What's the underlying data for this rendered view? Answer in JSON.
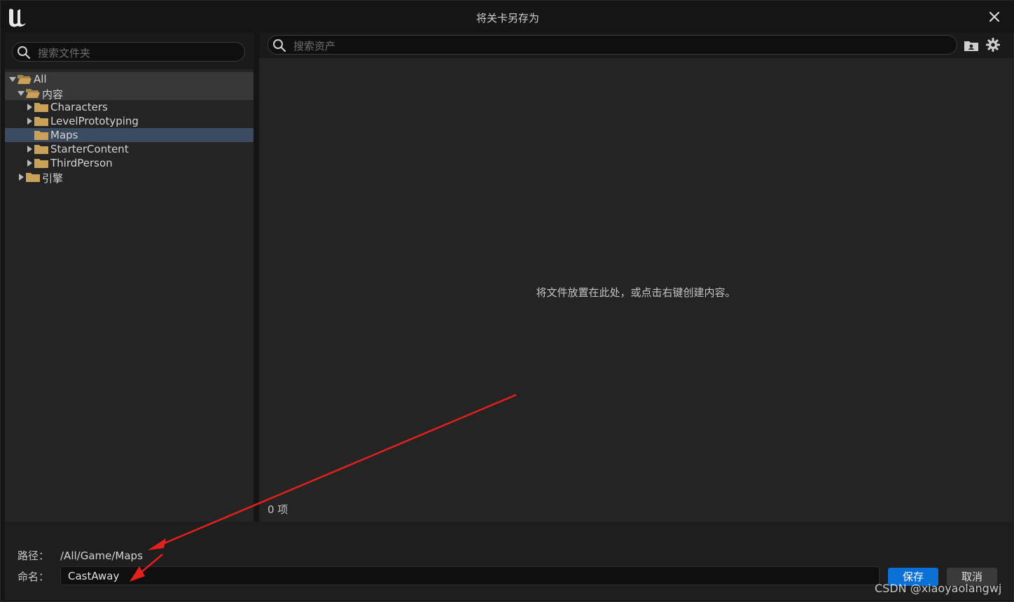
{
  "window": {
    "title": "将关卡另存为"
  },
  "folder_panel": {
    "search_placeholder": "搜索文件夹",
    "tree": [
      {
        "label": "All",
        "level": 0,
        "expanded": true,
        "has_children": true,
        "state": "parent"
      },
      {
        "label": "内容",
        "level": 1,
        "expanded": true,
        "has_children": true,
        "state": "parent"
      },
      {
        "label": "Characters",
        "level": 2,
        "expanded": false,
        "has_children": true,
        "state": ""
      },
      {
        "label": "LevelPrototyping",
        "level": 2,
        "expanded": false,
        "has_children": true,
        "state": ""
      },
      {
        "label": "Maps",
        "level": 2,
        "expanded": false,
        "has_children": false,
        "state": "selected"
      },
      {
        "label": "StarterContent",
        "level": 2,
        "expanded": false,
        "has_children": true,
        "state": ""
      },
      {
        "label": "ThirdPerson",
        "level": 2,
        "expanded": false,
        "has_children": true,
        "state": ""
      },
      {
        "label": "引擎",
        "level": 1,
        "expanded": false,
        "has_children": true,
        "state": ""
      }
    ]
  },
  "asset_panel": {
    "search_placeholder": "搜索资产",
    "empty_message": "将文件放置在此处，或点击右键创建内容。",
    "item_count": "0 项"
  },
  "save_form": {
    "path_label": "路径：",
    "path_value": "/All/Game/Maps",
    "name_label": "命名：",
    "name_value": "CastAway",
    "save_label": "保存",
    "cancel_label": "取消"
  },
  "watermark": "CSDN @xiaoyaolangwj",
  "colors": {
    "accent": "#0a70d6",
    "selection": "#3a4a60",
    "folder": "#c9a15a",
    "annotation": "#e3201b"
  }
}
